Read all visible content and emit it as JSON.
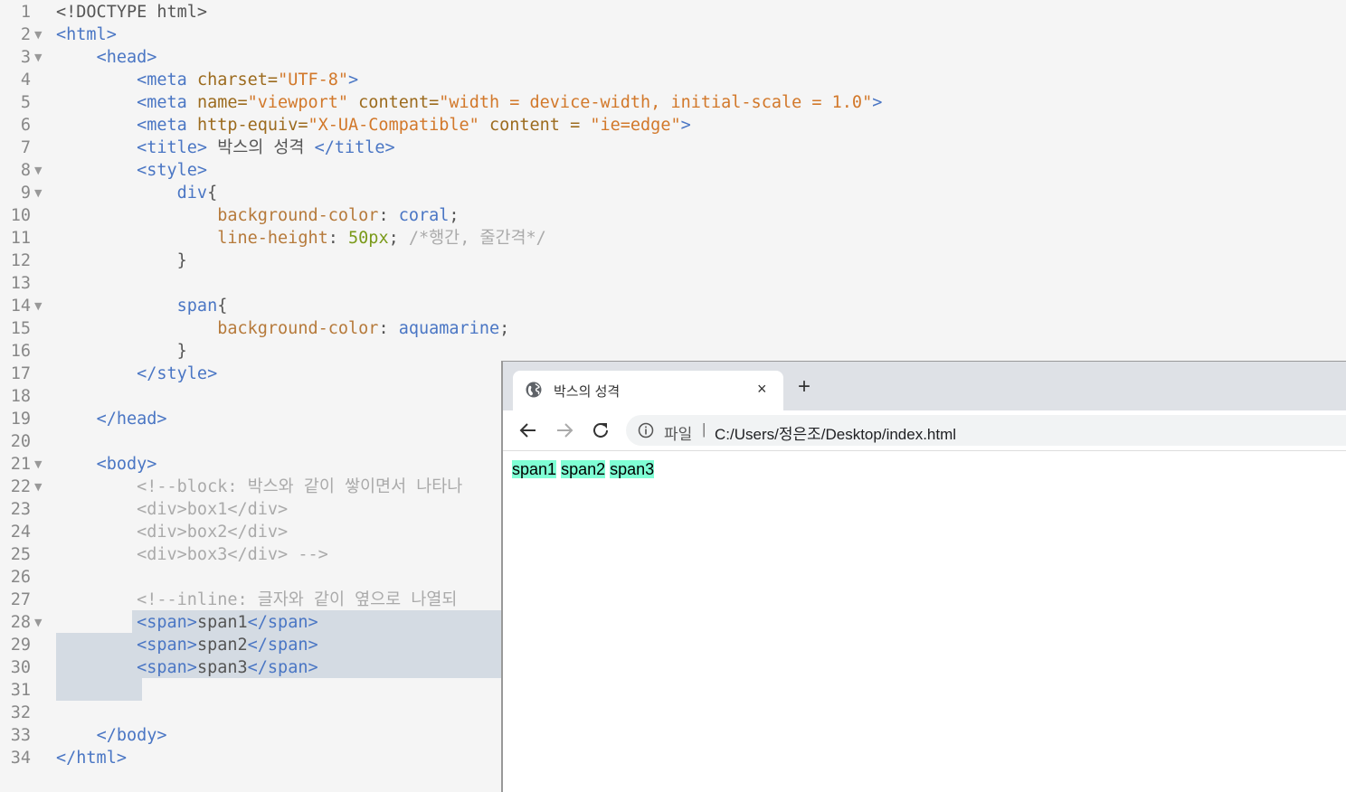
{
  "editor": {
    "line_numbers": [
      "1",
      "2",
      "3",
      "4",
      "5",
      "6",
      "7",
      "8",
      "9",
      "10",
      "11",
      "12",
      "13",
      "14",
      "15",
      "16",
      "17",
      "18",
      "19",
      "20",
      "21",
      "22",
      "23",
      "24",
      "25",
      "26",
      "27",
      "28",
      "29",
      "30",
      "31",
      "32",
      "33",
      "34"
    ],
    "fold_marker": "▼",
    "tokens": {
      "doctype": "<!DOCTYPE html>",
      "html_open": "<html>",
      "head_open": "<head>",
      "meta_open": "<meta",
      "tag_end": ">",
      "charset_attr": " charset=",
      "charset_val": "\"UTF-8\"",
      "name_attr": " name=",
      "viewport_val": "\"viewport\"",
      "content_attr": " content=",
      "viewport_content": "\"width = device-width, initial-scale = 1.0\"",
      "httpequiv_attr": " http-equiv=",
      "httpequiv_val": "\"X-UA-Compatible\"",
      "content_attr_spaced": " content = ",
      "ie_val": "\"ie=edge\"",
      "title_open": "<title>",
      "title_text": " 박스의 성격 ",
      "title_close": "</title>",
      "style_open": "<style>",
      "div_sel": "div",
      "brace_open": "{",
      "bg_prop": "background-color",
      "colon": ": ",
      "coral": "coral",
      "semi": ";",
      "lh_prop": "line-height",
      "lh_val": "50px",
      "lh_comment": "/*행간, 줄간격*/",
      "brace_close": "}",
      "span_sel": "span",
      "aquamarine": "aquamarine",
      "style_close": "</style>",
      "head_close": "</head>",
      "body_open": "<body>",
      "block_comment": "<!--block: 박스와 같이 쌓이면서 나타나",
      "div_box1": "<div>box1</div>",
      "div_box2": "<div>box2</div>",
      "div_box3": "<div>box3</div> -->",
      "inline_comment": "<!--inline: 글자와 같이 옆으로 나열되",
      "span_open": "<span>",
      "span_close": "</span>",
      "span1": "span1",
      "span2": "span2",
      "span3": "span3",
      "body_close": "</body>",
      "html_close": "</html>"
    }
  },
  "browser": {
    "tab_title": "박스의 성격",
    "tab_close": "×",
    "new_tab": "+",
    "file_label": "파일",
    "url_separator": "|",
    "url": "C:/Users/정은조/Desktop/index.html",
    "page_spans": [
      "span1",
      "span2",
      "span3"
    ],
    "span_bg": "#7fffd4"
  }
}
